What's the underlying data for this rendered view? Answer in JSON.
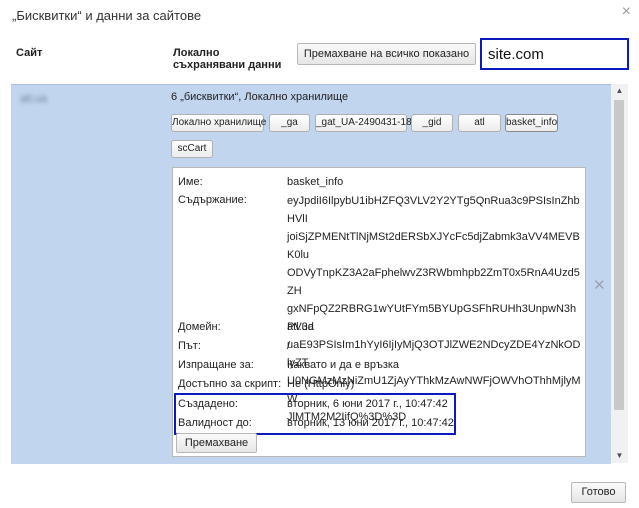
{
  "window": {
    "title": "„Бисквитки“ и данни за сайтове",
    "close_icon": "×"
  },
  "header": {
    "col_site": "Сайт",
    "col_local": "Локално съхранявани данни",
    "remove_all_label": "Премахване на всичко показано"
  },
  "search": {
    "value": "site.com",
    "placeholder": ""
  },
  "site": {
    "name": "atl.ua",
    "summary": "6 „бисквитки“, Локално хранилище",
    "chips": [
      "Локално хранилище",
      "_ga",
      "_gat_UA-2490431-18",
      "_gid",
      "atl",
      "basket_info",
      "scCart"
    ]
  },
  "details": {
    "name_label": "Име:",
    "name_value": "basket_info",
    "content_label": "Съдържание:",
    "content_lines": [
      "eyJpdiI6IlpybU1ibHZFQ3VLV2Y2YTg5QnRua3c9PSIsInZhbHVlI",
      "joiSjZPMENtTlNjMSt2dERSbXJYcFc5djZabmk3aVV4MEVBK0lu",
      "ODVyTnpKZ3A2aFphelwvZ3RWbmhpb2ZmT0x5RnA4Uzd5ZH",
      "gxNFpQZ2RBRG1wYUtFYm5BYUpGSFhRUHh3UnpwN3hPV3d",
      "uaE93PSIsIm1hYyI6IjIyMjQ3OTJlZWE2NDcyZDE4YzNkODlyZT",
      "U0NGMzMzNiZmU1ZjAyYThkMzAwNWFjOWVhOThhMjlyMW",
      "JlMTM2M2IifQ%3D%3D"
    ],
    "domain_label": "Домейн:",
    "domain_value": "atl.ua",
    "path_label": "Път:",
    "path_value": "/",
    "send_label": "Изпращане за:",
    "send_value": "Каквато и да е връзка",
    "script_label": "Достъпно за скрипт:",
    "script_value": "Не (HttpOnly)",
    "created_label": "Създадено:",
    "created_value": "вторник, 6 юни 2017 г., 10:47:42",
    "expires_label": "Валидност до:",
    "expires_value": "вторник, 13 юни 2017 г., 10:47:42",
    "remove_label": "Премахване"
  },
  "row_delete_icon": "✕",
  "footer": {
    "done_label": "Готово"
  },
  "colors": {
    "highlight_border": "#0b1ac0",
    "selected_row_bg": "#c2d5ee"
  }
}
